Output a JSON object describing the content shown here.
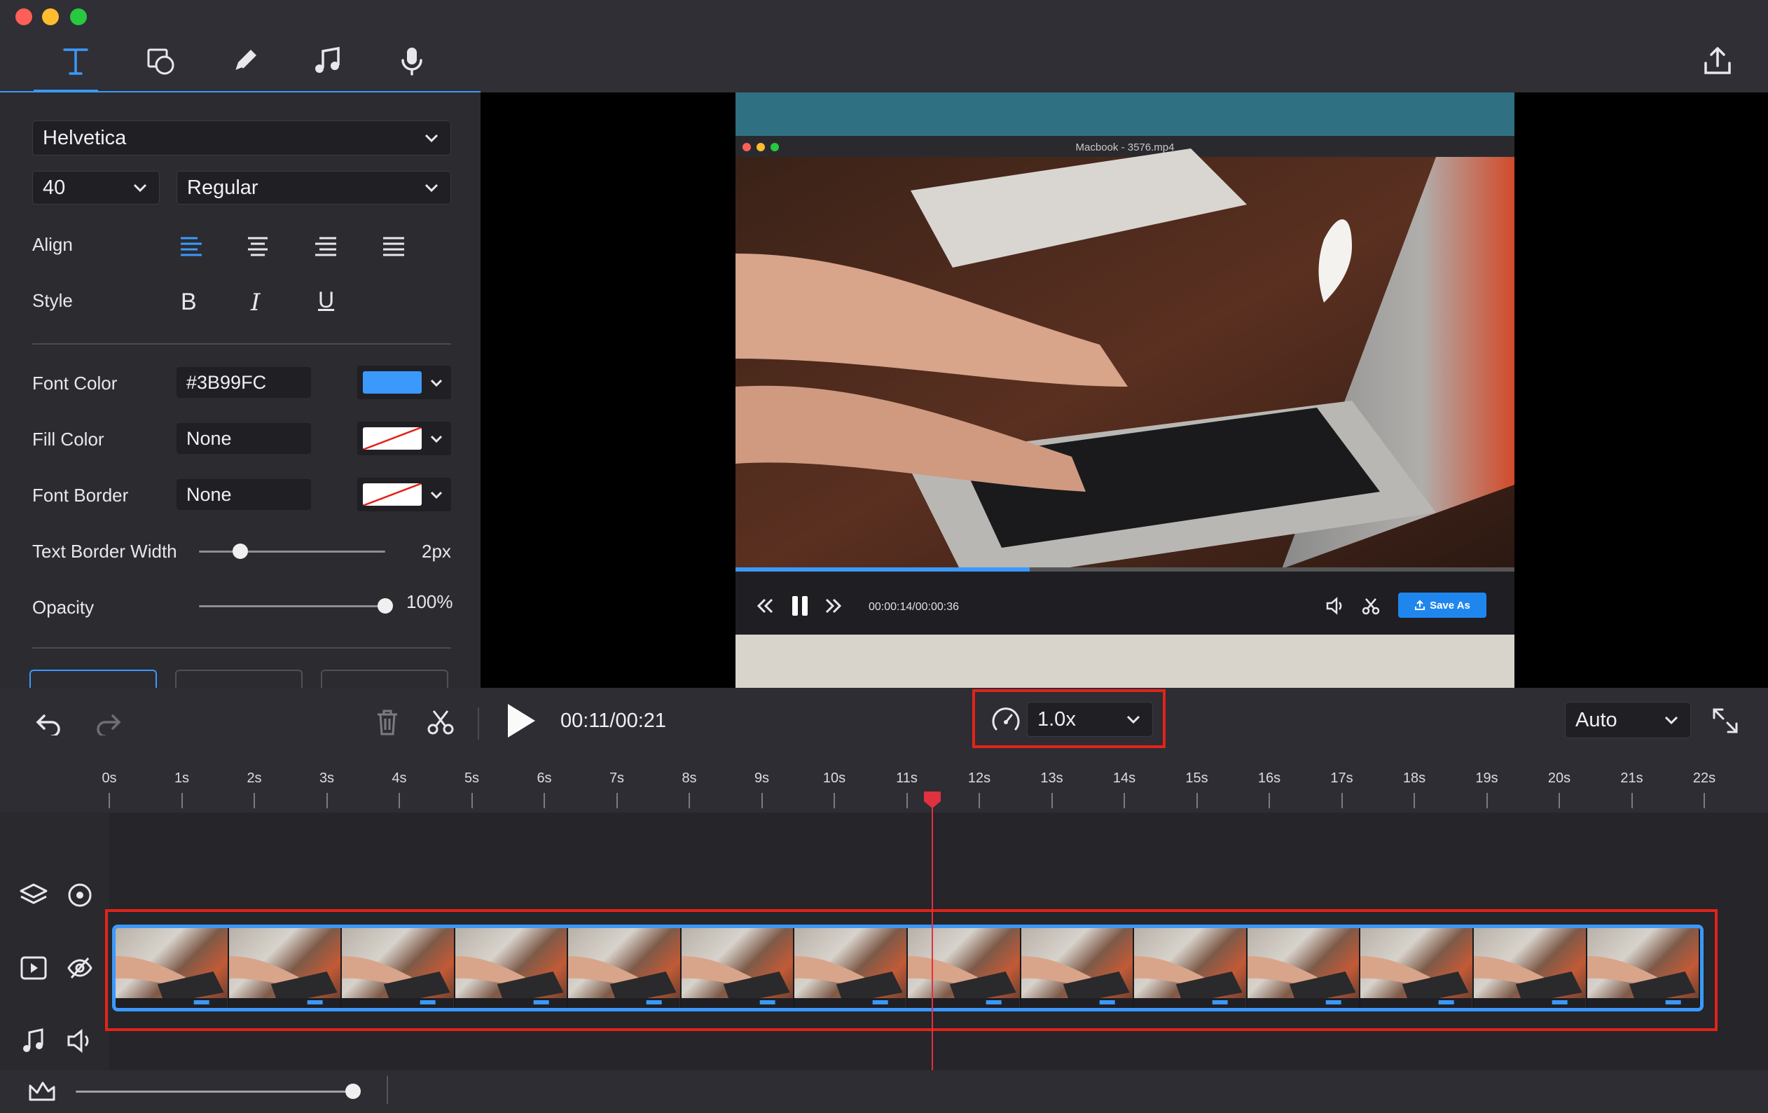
{
  "colors": {
    "accent": "#3b99fc",
    "highlight_red": "#e2231a",
    "playhead": "#e0313f",
    "window_close": "#ff5f57",
    "window_minimize": "#febc2e",
    "window_zoom": "#28c840"
  },
  "toolbar": {
    "tools": [
      {
        "name": "text-tool",
        "icon": "text-icon",
        "active": true
      },
      {
        "name": "shape-tool",
        "icon": "shape-icon",
        "active": false
      },
      {
        "name": "pen-tool",
        "icon": "pencil-icon",
        "active": false
      },
      {
        "name": "music-tool",
        "icon": "music-note-icon",
        "active": false
      },
      {
        "name": "record-tool",
        "icon": "microphone-icon",
        "active": false
      }
    ],
    "export_icon": "export-icon"
  },
  "text_panel": {
    "font_family": "Helvetica",
    "font_size": "40",
    "font_weight": "Regular",
    "align_label": "Align",
    "align_options": [
      "left",
      "center",
      "right",
      "justify"
    ],
    "align_selected": "left",
    "style_label": "Style",
    "style_bold": "B",
    "style_italic": "I",
    "style_underline": "U",
    "font_color_label": "Font Color",
    "font_color_value": "#3B99FC",
    "fill_color_label": "Fill Color",
    "fill_color_value": "None",
    "font_border_label": "Font Border",
    "font_border_value": "None",
    "text_border_width_label": "Text Border Width",
    "text_border_width_value": "2px",
    "text_border_width_level": 0.22,
    "opacity_label": "Opacity",
    "opacity_value": "100%",
    "opacity_level": 1.0
  },
  "video_preview": {
    "window_title": "Macbook - 3576.mp4",
    "timecode": "00:00:14/00:00:36",
    "save_label": "Save As",
    "progress": 0.38
  },
  "controls": {
    "current_time": "00:11/00:21",
    "speed": "1.0x",
    "zoom_mode": "Auto"
  },
  "timeline": {
    "ticks": [
      "0s",
      "1s",
      "2s",
      "3s",
      "4s",
      "5s",
      "6s",
      "7s",
      "8s",
      "9s",
      "10s",
      "11s",
      "12s",
      "13s",
      "14s",
      "15s",
      "16s",
      "17s",
      "18s",
      "19s",
      "20s",
      "21s",
      "22s"
    ],
    "playhead_seconds": 11.35,
    "frame_count": 14,
    "zoom_level": 0.98
  }
}
